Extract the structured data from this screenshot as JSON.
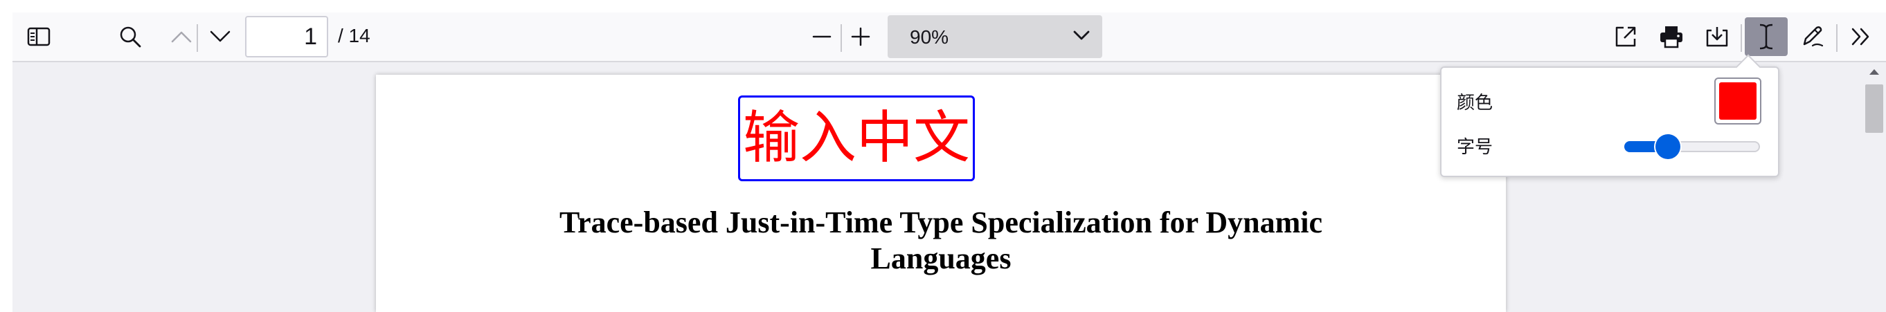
{
  "toolbar": {
    "page_number": "1",
    "page_total": "/ 14",
    "zoom_value": "90%",
    "icons": {
      "sidebar": "sidebar-toggle-icon",
      "find": "search-icon",
      "prev": "chevron-up-icon",
      "next": "chevron-down-icon",
      "zoom_out": "minus-icon",
      "zoom_in": "plus-icon",
      "open": "open-external-icon",
      "print": "printer-icon",
      "save": "download-icon",
      "text_tool": "text-cursor-icon",
      "draw_tool": "pen-icon",
      "more": "double-chevron-right-icon"
    }
  },
  "document": {
    "annotation_text": "输入中文",
    "annotation_color": "#ff0000",
    "annotation_border_color": "#0000ff",
    "title_line1": "Trace-based Just-in-Time Type Specialization for Dynamic",
    "title_line2": "Languages"
  },
  "text_editor_popover": {
    "color_label": "颜色",
    "color_value": "#ff0000",
    "size_label": "字号",
    "size_level": 0.32
  },
  "colors": {
    "accent": "#0060df",
    "active_tool_bg": "#8f8f9d"
  }
}
